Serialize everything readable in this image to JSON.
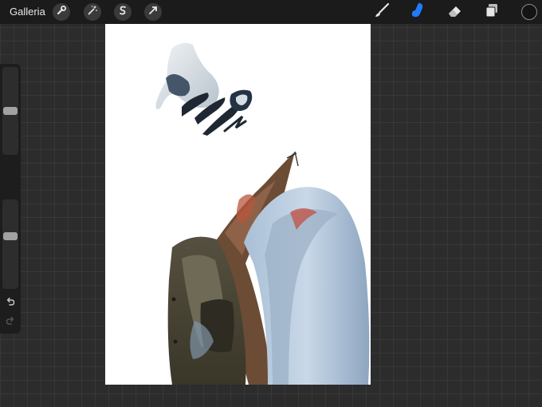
{
  "topbar": {
    "gallery_label": "Galleria"
  },
  "icons": {
    "actions": "wrench-icon",
    "adjustments": "magic-wand-icon",
    "selection": "selection-s-icon",
    "transform": "arrow-cursor-icon",
    "brush": "brush-icon",
    "smudge": "smudge-finger-icon",
    "eraser": "eraser-icon",
    "layers": "layers-icon",
    "undo": "undo-arrow-icon",
    "redo": "redo-arrow-icon"
  },
  "colors": {
    "active_tool": "#1f7bff",
    "current_color": "#141414"
  },
  "sidebar": {
    "brush_size_level": 0.5,
    "opacity_level": 0.6
  }
}
